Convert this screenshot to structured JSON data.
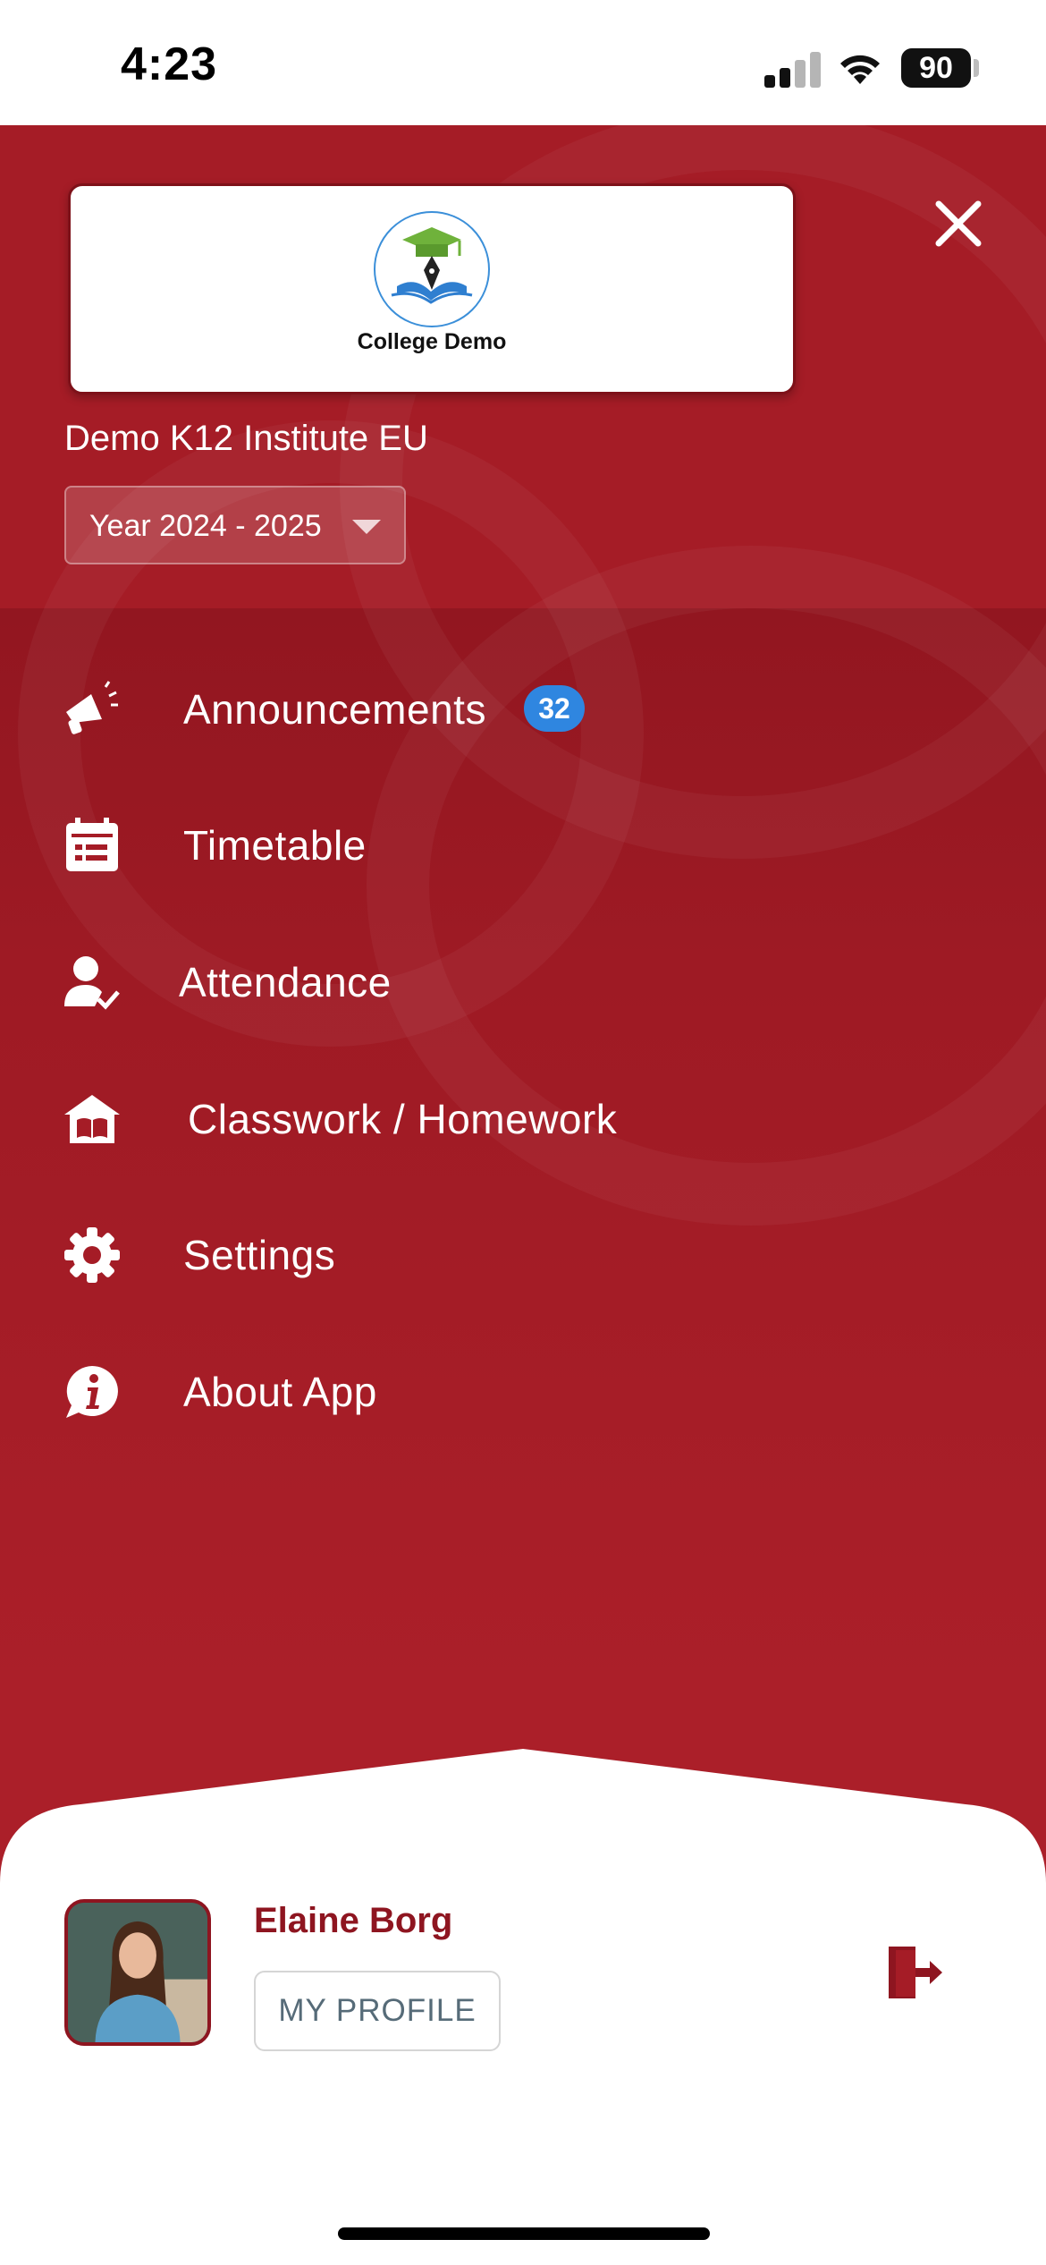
{
  "status_bar": {
    "time": "4:23",
    "battery": "90"
  },
  "header": {
    "logo_text": "College Demo",
    "institute": "Demo K12 Institute EU",
    "year": "Year 2024 - 2025"
  },
  "menu": [
    {
      "label": "Announcements",
      "icon": "megaphone-icon",
      "badge": "32"
    },
    {
      "label": "Timetable",
      "icon": "calendar-icon"
    },
    {
      "label": "Attendance",
      "icon": "person-check-icon"
    },
    {
      "label": "Classwork / Homework",
      "icon": "school-book-icon"
    },
    {
      "label": "Settings",
      "icon": "gear-icon"
    },
    {
      "label": "About App",
      "icon": "info-bubble-icon"
    }
  ],
  "profile": {
    "name": "Elaine Borg",
    "button": "MY PROFILE"
  },
  "colors": {
    "drawer_red": "#a51c26",
    "accent_dark_red": "#8e1520",
    "badge_blue": "#2f86e0"
  }
}
